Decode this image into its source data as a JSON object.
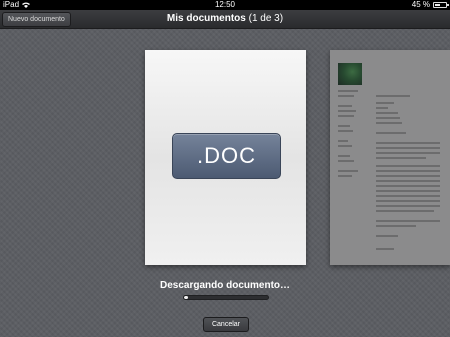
{
  "status_bar": {
    "device": "iPad",
    "time": "12:50",
    "battery": "45 %",
    "battery_level": 0.45
  },
  "nav": {
    "new_doc_label": "Nuevo documento",
    "title": "Mis documentos",
    "count": "(1 de 3)"
  },
  "document": {
    "badge": ".DOC"
  },
  "download": {
    "label": "Descargando documento…",
    "progress": 0.05
  },
  "cancel_label": "Cancelar"
}
